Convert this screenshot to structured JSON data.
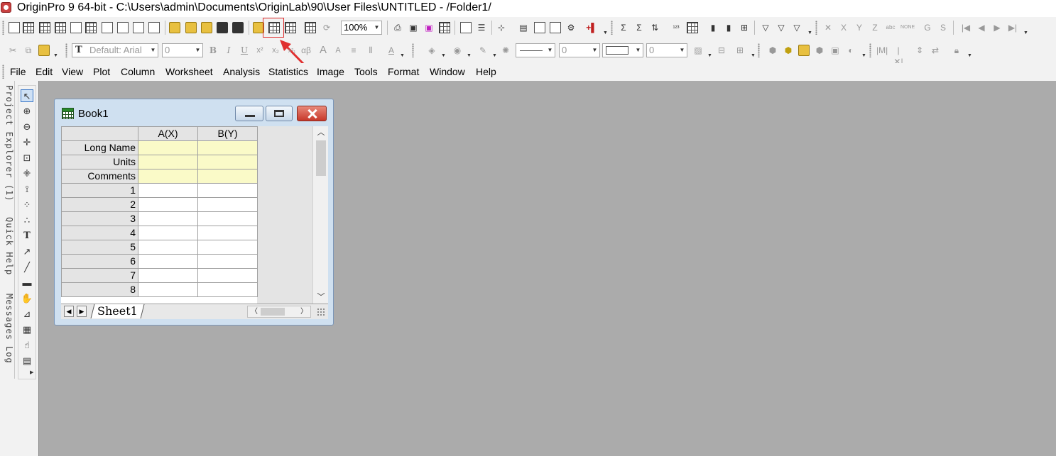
{
  "window": {
    "title": "OriginPro 9 64-bit - C:\\Users\\admin\\Documents\\OriginLab\\90\\User Files\\UNTITLED - /Folder1/"
  },
  "toolbar": {
    "zoom_value": "100%",
    "font_name": "Default: Arial",
    "font_size": "0",
    "line_width": "0",
    "symbol_size": "0",
    "rotation": "0",
    "bold": "B",
    "italic": "I",
    "underline": "U",
    "superscript": "x²",
    "subscript": "x₂",
    "greek": "αβ",
    "increase_font": "A",
    "decrease_font": "A",
    "text_color": "A",
    "set_column_x": "X",
    "set_column_y": "Y",
    "set_column_z": "Z",
    "group": "G",
    "subgroup": "S"
  },
  "menubar": {
    "items": [
      "File",
      "Edit",
      "View",
      "Plot",
      "Column",
      "Worksheet",
      "Analysis",
      "Statistics",
      "Image",
      "Tools",
      "Format",
      "Window",
      "Help"
    ]
  },
  "dock": {
    "project_explorer": "Project Explorer (1)",
    "quick_help": "Quick Help",
    "messages_log": "Messages Log"
  },
  "book": {
    "title": "Book1",
    "columns": [
      "A(X)",
      "B(Y)"
    ],
    "meta_rows": [
      "Long Name",
      "Units",
      "Comments"
    ],
    "rows": [
      "1",
      "2",
      "3",
      "4",
      "5",
      "6",
      "7",
      "8"
    ],
    "sheet_tab": "Sheet1"
  },
  "colors": {
    "highlight_box": "#e03030",
    "annotation_arrow": "#e03030",
    "meta_row_bg": "#fafac8",
    "workspace_bg": "#ababab"
  }
}
